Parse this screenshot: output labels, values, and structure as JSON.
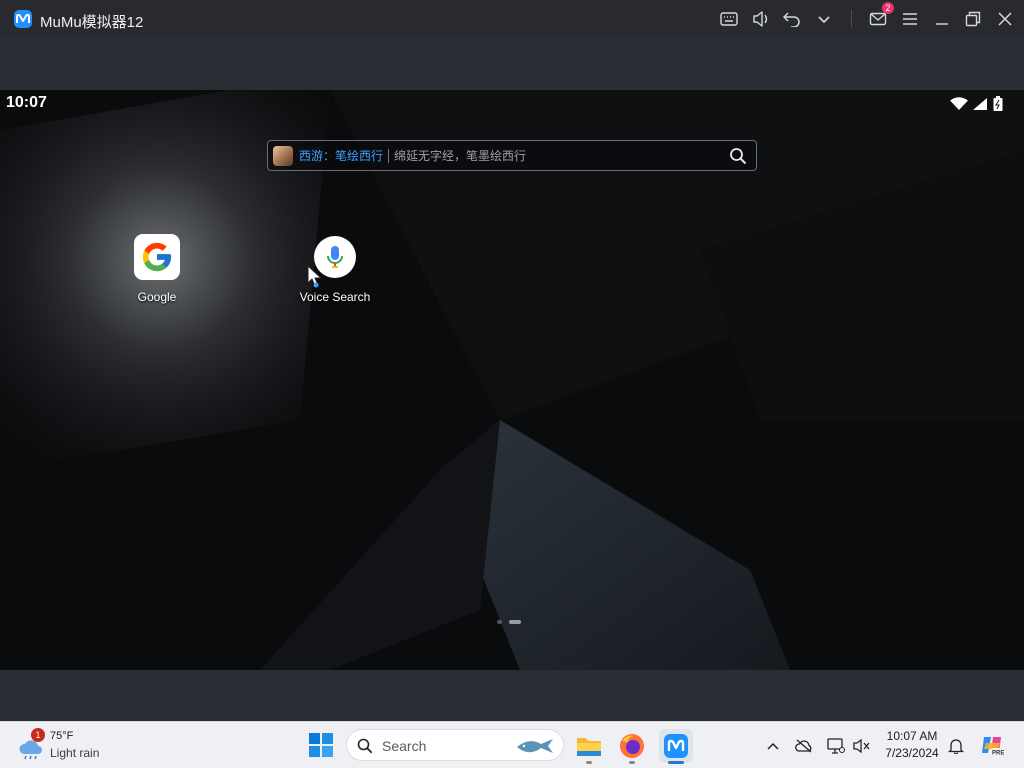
{
  "window": {
    "title": "MuMu模拟器12",
    "mail_badge": "2",
    "controls": [
      "keyboard-icon",
      "volume-icon",
      "back-icon",
      "chevron-down-icon",
      "mail-icon",
      "menu-icon",
      "minimize-icon",
      "restore-icon",
      "close-icon"
    ]
  },
  "android": {
    "status": {
      "time": "10:07"
    },
    "search_widget": {
      "title": "西游：笔绘西行",
      "subtitle": "绵延无字经，笔墨绘西行"
    },
    "apps": [
      {
        "label": "Google",
        "icon": "google-g-icon"
      },
      {
        "label": "Voice Search",
        "icon": "microphone-icon"
      }
    ],
    "pages": {
      "count": 2,
      "current": 2
    }
  },
  "taskbar": {
    "weather": {
      "temp": "75°F",
      "desc": "Light rain",
      "badge": "1"
    },
    "search_placeholder": "Search",
    "apps": [
      "file-explorer-icon",
      "firefox-icon",
      "mumu-icon"
    ],
    "tray": {
      "time": "10:07 AM",
      "date": "7/23/2024"
    }
  },
  "colors": {
    "accent": "#3aa0ff",
    "badge": "#e8336b"
  }
}
